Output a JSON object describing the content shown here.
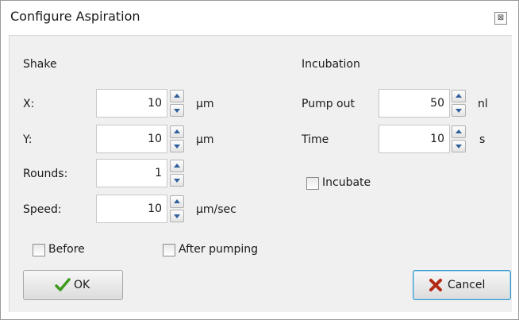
{
  "window": {
    "title": "Configure Aspiration",
    "close_glyph": "⊠"
  },
  "shake": {
    "title": "Shake",
    "x": {
      "label": "X:",
      "value": "10",
      "unit": "μm"
    },
    "y": {
      "label": "Y:",
      "value": "10",
      "unit": "μm"
    },
    "rounds": {
      "label": "Rounds:",
      "value": "1"
    },
    "speed": {
      "label": "Speed:",
      "value": "10",
      "unit": "μm/sec"
    }
  },
  "incubation": {
    "title": "Incubation",
    "pump_out": {
      "label": "Pump out",
      "value": "50",
      "unit": "nl"
    },
    "time": {
      "label": "Time",
      "value": "10",
      "unit": "s"
    },
    "incubate_label": "Incubate",
    "incubate_checked": false
  },
  "options": {
    "before_label": "Before",
    "before_checked": false,
    "after_label": "After pumping",
    "after_checked": false
  },
  "buttons": {
    "ok_label": "OK",
    "cancel_label": "Cancel",
    "ok_icon": "checkmark-icon",
    "cancel_icon": "x-icon",
    "ok_icon_color": "#3e9b1d",
    "cancel_icon_color": "#b22a14"
  }
}
